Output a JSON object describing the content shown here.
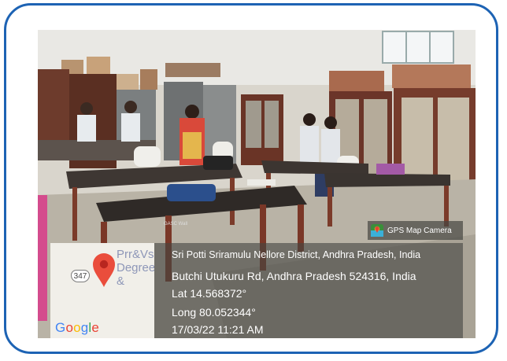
{
  "badge": {
    "label": "GPS Map Camera",
    "icon": "gps-map-camera-icon"
  },
  "map": {
    "place_label": "Prr&Vs\nDegree\n&",
    "road_shield": "347",
    "brand": "Google",
    "pin_icon": "location-pin-icon",
    "brand_colors": [
      "#4285F4",
      "#EA4335",
      "#FBBC05",
      "#4285F4",
      "#34A853",
      "#EA4335"
    ]
  },
  "location": {
    "line1": "Sri Potti Sriramulu Nellore District, Andhra Pradesh, India",
    "line2": "Butchi Utukuru Rd, Andhra Pradesh 524316, India",
    "lat": "Lat 14.568372°",
    "long": "Long 80.052344°",
    "datetime": "17/03/22 11:21 AM"
  },
  "photo": {
    "bench_label": "GASC Wall"
  },
  "colors": {
    "frame": "#1d63b4"
  }
}
